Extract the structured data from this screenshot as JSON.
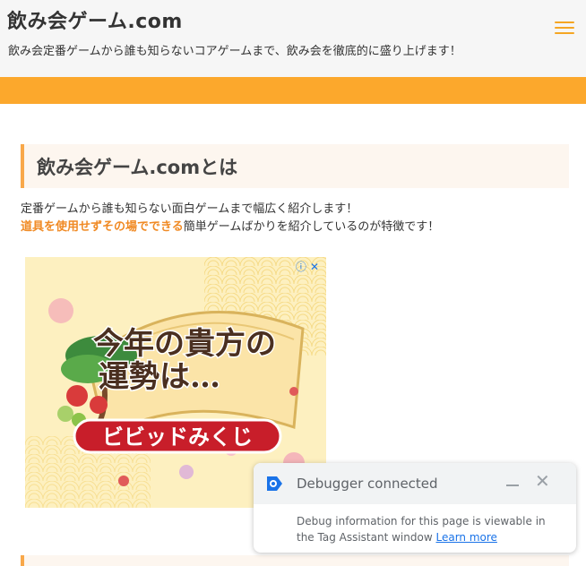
{
  "header": {
    "site_title": "飲み会ゲーム.com",
    "site_description": "飲み会定番ゲームから誰も知らないコアゲームまで、飲み会を徹底的に盛り上げます！",
    "menu_icon": "hamburger-menu-icon",
    "accent_color": "#f5a623"
  },
  "band": {
    "color": "#fca82c"
  },
  "main": {
    "section_heading": "飲み会ゲーム.comとは",
    "intro_line1": "定番ゲームから誰も知らない面白ゲームまで幅広く紹介します！",
    "intro_line2_highlight": "道具を使用せずその場でできる",
    "intro_line2_rest": "簡単ゲームばかりを紹介しているのが特徴です！",
    "highlight_color": "#f08a24"
  },
  "ad": {
    "headline_line1": "今年の貴方の",
    "headline_line2": "運勢は…",
    "banner_text": "ビビッドみくじ",
    "badge_icons": [
      "ad-info-icon",
      "ad-close-icon"
    ]
  },
  "debugger": {
    "title": "Debugger connected",
    "body": "Debug information for this page is viewable in the Tag Assistant window",
    "link": "Learn more",
    "icon": "tag-assistant-icon"
  }
}
